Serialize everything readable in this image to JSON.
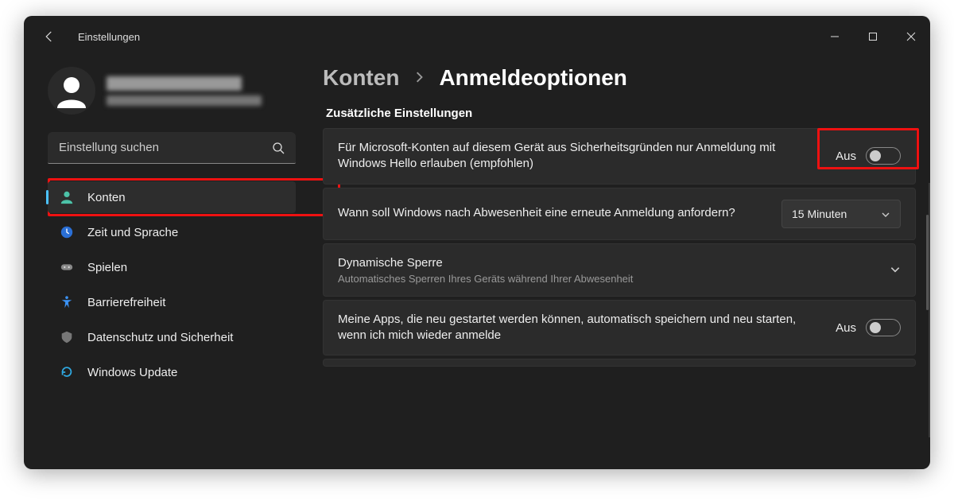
{
  "app": {
    "title": "Einstellungen"
  },
  "search": {
    "placeholder": "Einstellung suchen"
  },
  "sidebar": {
    "items": [
      {
        "label": "Konten"
      },
      {
        "label": "Zeit und Sprache"
      },
      {
        "label": "Spielen"
      },
      {
        "label": "Barrierefreiheit"
      },
      {
        "label": "Datenschutz und Sicherheit"
      },
      {
        "label": "Windows Update"
      }
    ]
  },
  "breadcrumb": {
    "parent": "Konten",
    "current": "Anmeldeoptionen"
  },
  "section": {
    "header": "Zusätzliche Einstellungen"
  },
  "cards": {
    "hello": {
      "text": "Für Microsoft-Konten auf diesem Gerät aus Sicherheitsgründen nur Anmeldung mit Windows Hello erlauben (empfohlen)",
      "toggle_label": "Aus"
    },
    "signin_after": {
      "text": "Wann soll Windows nach Abwesenheit eine erneute Anmeldung anfordern?",
      "dropdown_value": "15 Minuten"
    },
    "dynamic_lock": {
      "title": "Dynamische Sperre",
      "sub": "Automatisches Sperren Ihres Geräts während Ihrer Abwesenheit"
    },
    "restart_apps": {
      "text": "Meine Apps, die neu gestartet werden können, automatisch speichern und neu starten, wenn ich mich wieder anmelde",
      "toggle_label": "Aus"
    }
  }
}
